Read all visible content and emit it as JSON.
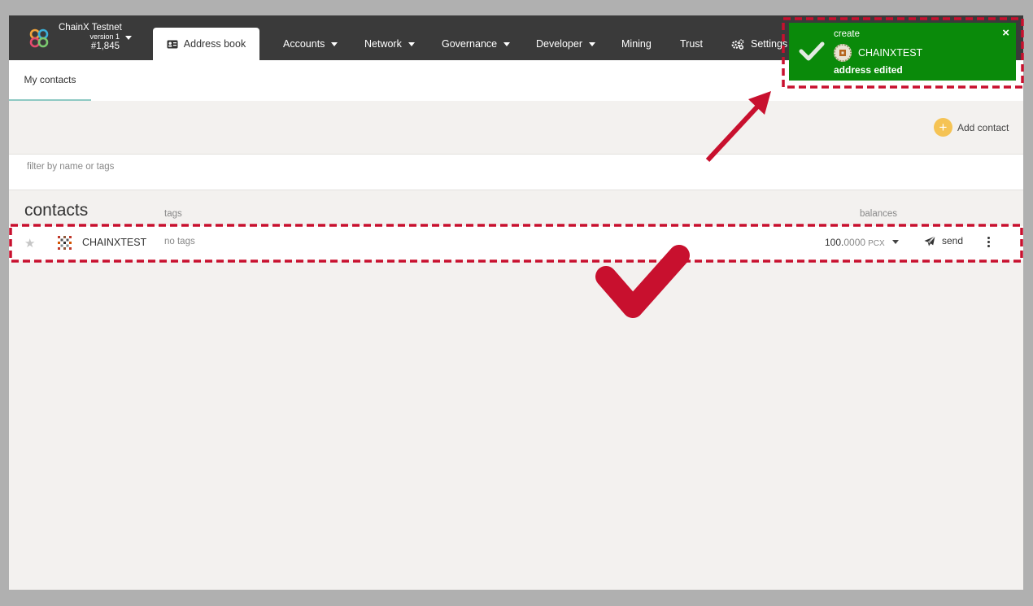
{
  "header": {
    "chain_name": "ChainX Testnet",
    "version": "version 1",
    "block": "#1,845",
    "nav": {
      "address_book": "Address book",
      "accounts": "Accounts",
      "network": "Network",
      "governance": "Governance",
      "developer": "Developer",
      "mining": "Mining",
      "trust": "Trust",
      "settings": "Settings"
    }
  },
  "tabs": {
    "my_contacts": "My contacts"
  },
  "actions": {
    "add_contact": "Add contact",
    "add_icon": "plus-icon"
  },
  "filter": {
    "placeholder": "filter by name or tags",
    "value": ""
  },
  "table": {
    "headers": {
      "contacts": "contacts",
      "tags": "tags",
      "balances": "balances"
    },
    "rows": [
      {
        "name": "CHAINXTEST",
        "tags": "no tags",
        "balance_int": "100.",
        "balance_dec": "0000",
        "unit": "PCX",
        "send": "send",
        "favorite": false
      }
    ]
  },
  "toast": {
    "action": "create",
    "account": "CHAINXTEST",
    "message": "address edited",
    "close": "×",
    "status": "success",
    "color": "#0a8a0a"
  },
  "colors": {
    "topbar": "#3a3a3a",
    "background": "#f3f1ef",
    "accent": "#f5c354",
    "annotation": "#d0021b"
  }
}
